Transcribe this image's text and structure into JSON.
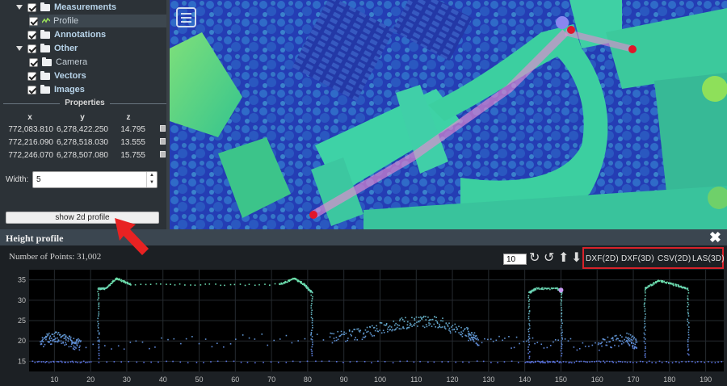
{
  "sidebar": {
    "tree": [
      {
        "label": "Measurements",
        "indent": 1,
        "type": "folder",
        "expanded": true
      },
      {
        "label": "Profile",
        "indent": 2,
        "type": "profile",
        "selected": true
      },
      {
        "label": "Annotations",
        "indent": 1,
        "type": "folder"
      },
      {
        "label": "Other",
        "indent": 1,
        "type": "folder",
        "expanded": true
      },
      {
        "label": "Camera",
        "indent": 2,
        "type": "folder"
      },
      {
        "label": "Vectors",
        "indent": 1,
        "type": "folder"
      },
      {
        "label": "Images",
        "indent": 1,
        "type": "folder"
      }
    ],
    "properties_title": "Properties",
    "coords": {
      "headers": [
        "x",
        "y",
        "z"
      ],
      "rows": [
        [
          "772,083.810",
          "6,278,422.250",
          "14.795"
        ],
        [
          "772,216.090",
          "6,278,518.030",
          "13.555"
        ],
        [
          "772,246.070",
          "6,278,507.080",
          "15.755"
        ]
      ]
    },
    "width_label": "Width:",
    "width_value": "5",
    "show_2d_label": "show 2d profile"
  },
  "profile": {
    "title": "Height profile",
    "points_label": "Number of Points:",
    "points_value": "31,002",
    "lod_value": "10",
    "exports": [
      "DXF(2D)",
      "DXF(3D)",
      "CSV(2D)",
      "LAS(3D)"
    ],
    "colors": {
      "highlight_box": "#d8222a",
      "annotation_arrow": "#e82222"
    }
  },
  "chart_data": {
    "type": "scatter",
    "title": "",
    "xlabel": "",
    "ylabel": "",
    "xlim": [
      3,
      195
    ],
    "ylim": [
      12.5,
      37.5
    ],
    "xticks": [
      10,
      20,
      30,
      40,
      50,
      60,
      70,
      80,
      90,
      100,
      110,
      120,
      130,
      140,
      150,
      160,
      170,
      180,
      190
    ],
    "yticks": [
      15,
      20,
      25,
      30,
      35
    ],
    "grid": true,
    "series": [
      {
        "name": "",
        "kind": "ground",
        "points": [
          [
            4,
            15
          ],
          [
            20,
            15
          ],
          [
            82,
            15
          ],
          [
            140,
            15
          ],
          [
            150,
            15
          ],
          [
            168,
            15
          ],
          [
            195,
            15
          ]
        ]
      },
      {
        "name": "",
        "kind": "building-1",
        "points": [
          [
            22,
            16
          ],
          [
            22,
            33
          ],
          [
            24,
            33
          ],
          [
            27,
            35.5
          ],
          [
            31,
            34
          ],
          [
            72,
            34
          ],
          [
            76,
            35.5
          ],
          [
            79,
            34
          ],
          [
            81,
            32
          ],
          [
            81,
            16
          ]
        ]
      },
      {
        "name": "",
        "kind": "building-2",
        "points": [
          [
            141,
            16
          ],
          [
            141,
            32
          ],
          [
            143,
            33
          ],
          [
            149,
            33
          ],
          [
            150,
            32
          ],
          [
            150,
            16
          ]
        ]
      },
      {
        "name": "",
        "kind": "building-3",
        "points": [
          [
            173,
            16
          ],
          [
            173,
            33
          ],
          [
            177,
            35
          ],
          [
            181,
            34
          ],
          [
            185,
            33
          ],
          [
            185,
            16
          ]
        ]
      },
      {
        "name": "",
        "kind": "vegetation",
        "points": [
          [
            6,
            20
          ],
          [
            10,
            21
          ],
          [
            14,
            20
          ],
          [
            17,
            19
          ],
          [
            86,
            21
          ],
          [
            95,
            22
          ],
          [
            103,
            24
          ],
          [
            110,
            25
          ],
          [
            117,
            24.5
          ],
          [
            124,
            22
          ],
          [
            127,
            20
          ],
          [
            160,
            19
          ],
          [
            168,
            21
          ],
          [
            171,
            19
          ]
        ]
      },
      {
        "name": "",
        "kind": "marker",
        "points": [
          [
            150,
            32.5
          ]
        ]
      }
    ]
  }
}
